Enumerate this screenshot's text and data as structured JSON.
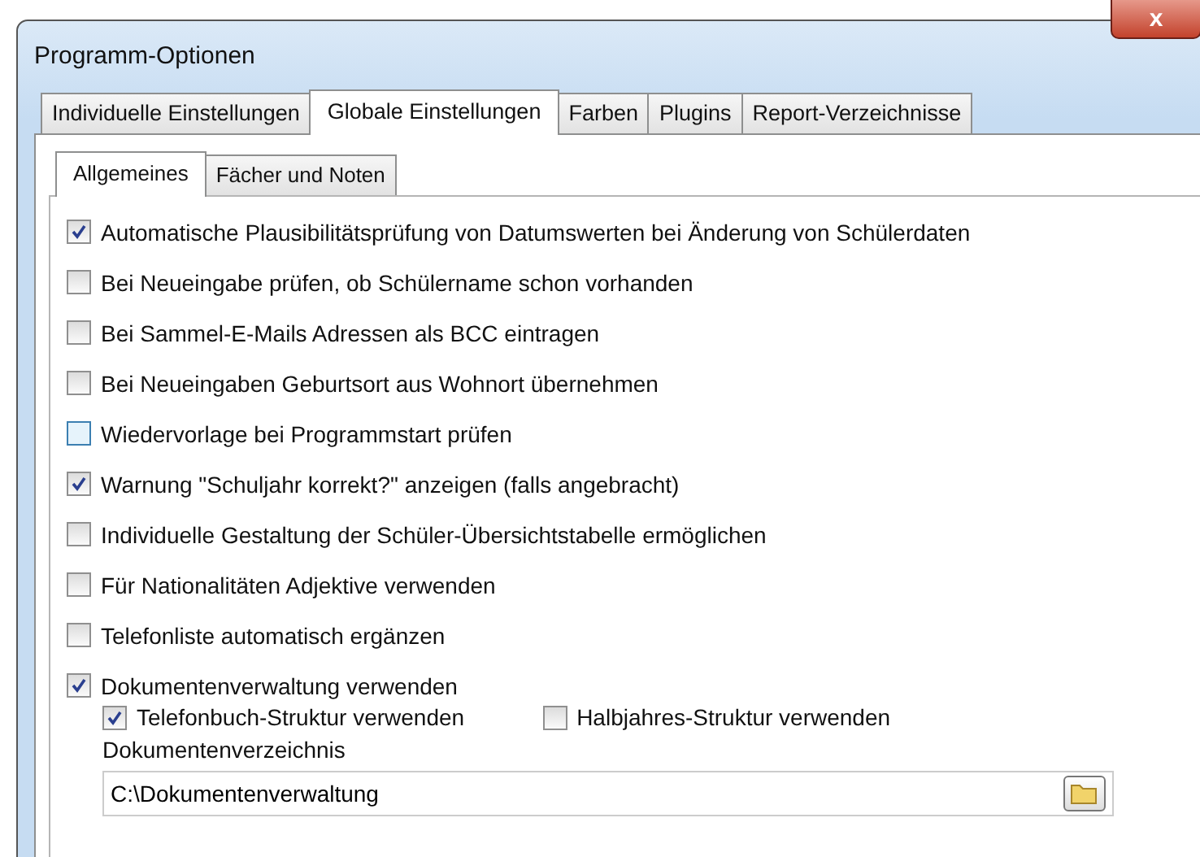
{
  "window": {
    "title": "Programm-Optionen",
    "close": "x"
  },
  "tabs": [
    {
      "label": "Individuelle Einstellungen",
      "selected": false
    },
    {
      "label": "Globale Einstellungen",
      "selected": true
    },
    {
      "label": "Farben",
      "selected": false
    },
    {
      "label": "Plugins",
      "selected": false
    },
    {
      "label": "Report-Verzeichnisse",
      "selected": false
    }
  ],
  "subtabs": [
    {
      "label": "Allgemeines",
      "selected": true
    },
    {
      "label": "Fächer und Noten",
      "selected": false
    }
  ],
  "options": [
    {
      "label": "Automatische Plausibilitätsprüfung von Datumswerten bei Änderung von Schülerdaten",
      "checked": true
    },
    {
      "label": "Bei Neueingabe prüfen, ob Schülername schon vorhanden",
      "checked": false
    },
    {
      "label": "Bei Sammel-E-Mails Adressen als BCC eintragen",
      "checked": false
    },
    {
      "label": "Bei Neueingaben Geburtsort aus Wohnort übernehmen",
      "checked": false
    },
    {
      "label": "Wiedervorlage bei Programmstart prüfen",
      "checked": false,
      "hovered": true
    },
    {
      "label": "Warnung \"Schuljahr korrekt?\" anzeigen (falls angebracht)",
      "checked": true
    },
    {
      "label": "Individuelle Gestaltung der Schüler-Übersichtstabelle ermöglichen",
      "checked": false
    },
    {
      "label": "Für Nationalitäten Adjektive verwenden",
      "checked": false
    },
    {
      "label": "Telefonliste automatisch ergänzen",
      "checked": false
    },
    {
      "label": "Dokumentenverwaltung verwenden",
      "checked": true
    }
  ],
  "sub_options": [
    {
      "label": "Telefonbuch-Struktur verwenden",
      "checked": true
    },
    {
      "label": "Halbjahres-Struktur verwenden",
      "checked": false
    }
  ],
  "folder": {
    "label": "Dokumentenverzeichnis",
    "value": "C:\\Dokumentenverwaltung"
  }
}
